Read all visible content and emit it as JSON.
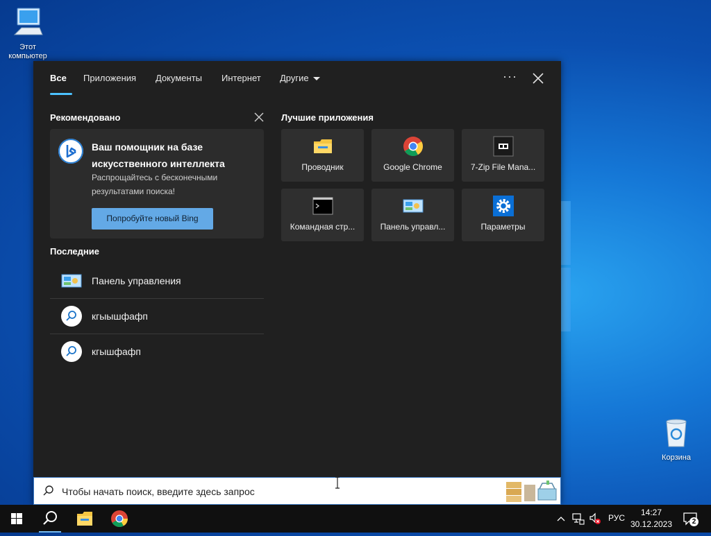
{
  "desktop": {
    "icons": [
      {
        "name": "this-pc",
        "label": "Этот\nкомпьютер"
      },
      {
        "name": "recycle-bin",
        "label": "Корзина"
      }
    ]
  },
  "search_panel": {
    "tabs": [
      {
        "label": "Все",
        "active": true
      },
      {
        "label": "Приложения"
      },
      {
        "label": "Документы"
      },
      {
        "label": "Интернет"
      },
      {
        "label": "Другие"
      }
    ],
    "more_label": "···",
    "recommended": {
      "title": "Рекомендовано",
      "card_title": "Ваш помощник на базе искусственного интеллекта",
      "card_subtitle": "Распрощайтесь с бесконечными результатами поиска!",
      "button_label": "Попробуйте новый Bing"
    },
    "recent": {
      "title": "Последние",
      "items": [
        {
          "label": "Панель управления",
          "icon": "control-panel-icon"
        },
        {
          "label": "кгыышфафп",
          "icon": "search-icon"
        },
        {
          "label": "кгышфафп",
          "icon": "search-icon"
        }
      ]
    },
    "top_apps": {
      "title": "Лучшие приложения",
      "items": [
        {
          "label": "Проводник",
          "icon": "file-explorer-icon"
        },
        {
          "label": "Google Chrome",
          "icon": "chrome-icon"
        },
        {
          "label": "7-Zip File Mana...",
          "icon": "7zip-icon"
        },
        {
          "label": "Командная стр...",
          "icon": "command-prompt-icon"
        },
        {
          "label": "Панель управл...",
          "icon": "control-panel-icon"
        },
        {
          "label": "Параметры",
          "icon": "settings-icon"
        }
      ]
    }
  },
  "search_box": {
    "placeholder": "Чтобы начать поиск, введите здесь запрос"
  },
  "taskbar": {
    "language": "РУС",
    "time": "14:27",
    "date": "30.12.2023",
    "notifications_count": "2"
  },
  "colors": {
    "accent": "#4cc2ff",
    "panel_bg": "#202020",
    "tile_bg": "#2f2f2f",
    "bing_button": "#63a9e6"
  }
}
